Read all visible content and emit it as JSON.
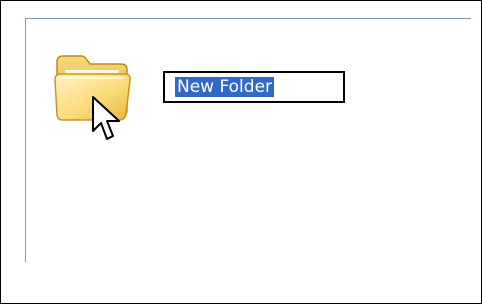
{
  "window": {
    "border_color": "#000000",
    "pane_border_color": "#7f9db9"
  },
  "item": {
    "icon": "folder-icon",
    "name": "New Folder",
    "state": "renaming",
    "selection_color": "#316ac5"
  },
  "pointer": {
    "icon": "arrow-cursor-icon"
  }
}
